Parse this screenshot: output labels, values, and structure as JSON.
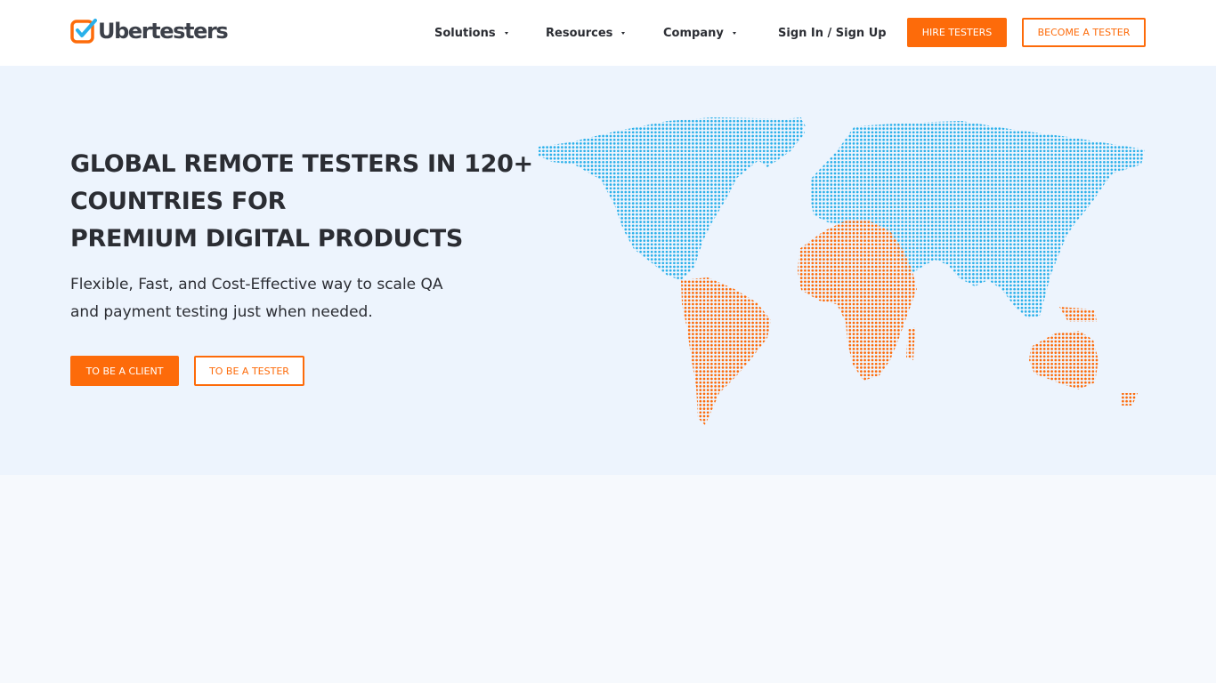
{
  "brand": {
    "name": "Ubertesters",
    "colors": {
      "accent": "#fd6b0a",
      "map_blue": "#2ab0ea",
      "map_orange": "#fd6b0a",
      "hero_bg": "#edf4fd"
    }
  },
  "nav": {
    "solutions": "Solutions",
    "resources": "Resources",
    "company": "Company",
    "sign_in": "Sign In / Sign Up",
    "hire_testers": "HIRE TESTERS",
    "become_tester": "BECOME A TESTER"
  },
  "hero": {
    "headline_line1": "GLOBAL REMOTE TESTERS IN 120+",
    "headline_line2": "COUNTRIES FOR",
    "headline_line3": "PREMIUM DIGITAL PRODUCTS",
    "sub_line1": "Flexible, Fast, and Cost-Effective way to scale QA",
    "sub_line2": "and payment testing just when needed.",
    "btn_client": "TO BE A CLIENT",
    "btn_tester": "TO BE A TESTER"
  },
  "icons": {
    "logo": "checkbox-check-icon",
    "dropdown": "caret-down-icon",
    "map": "dotted-world-map"
  }
}
